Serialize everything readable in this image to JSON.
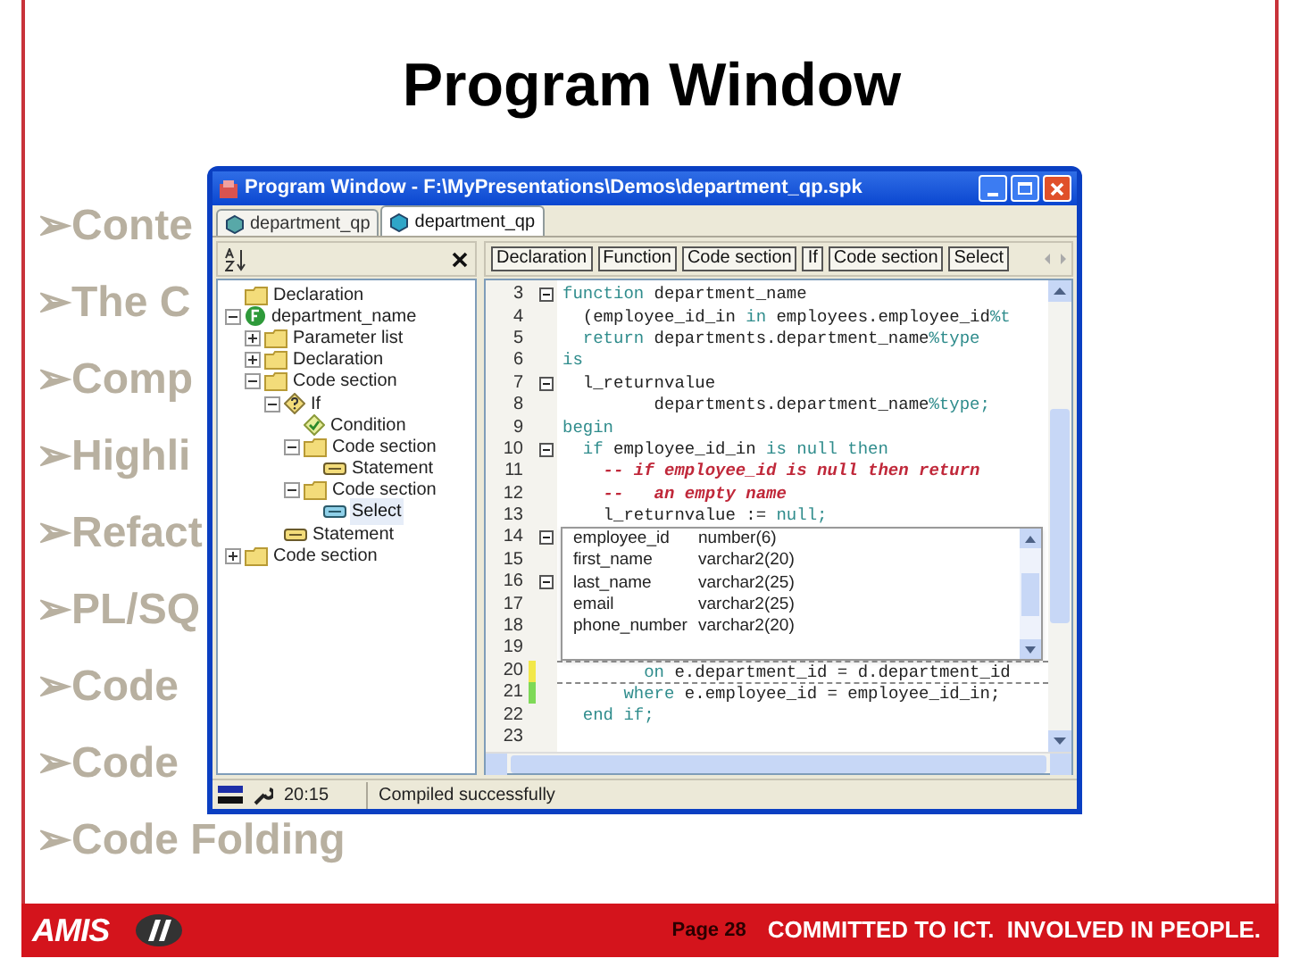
{
  "slide": {
    "title": "Program Window",
    "bullets": [
      "➢Conte",
      "➢The C",
      "➢Comp",
      "➢Highli",
      "➢Refact",
      "➢PL/SQ",
      "➢Code",
      "➢Code",
      "➢Code Folding"
    ],
    "footer": {
      "logo": "AMIS",
      "page": "Page 28",
      "slogan": "COMMITTED TO ICT.  INVOLVED IN PEOPLE."
    }
  },
  "window": {
    "title": "Program Window - F:\\MyPresentations\\Demos\\department_qp.spk",
    "tabs": [
      {
        "label": "department_qp",
        "selected": false
      },
      {
        "label": "department_qp",
        "selected": true
      }
    ],
    "tree": [
      {
        "label": "Declaration",
        "kind": "folder",
        "selected": false
      },
      {
        "label": "department_name",
        "kind": "function",
        "expanded": true,
        "selected": false,
        "children": [
          {
            "label": "Parameter list",
            "kind": "folder",
            "expanded": false,
            "selected": false
          },
          {
            "label": "Declaration",
            "kind": "folder",
            "expanded": false,
            "selected": false
          },
          {
            "label": "Code section",
            "kind": "folder",
            "expanded": true,
            "selected": false,
            "children": [
              {
                "label": "If",
                "kind": "if",
                "expanded": true,
                "selected": false,
                "children": [
                  {
                    "label": "Condition",
                    "kind": "condition",
                    "selected": false
                  },
                  {
                    "label": "Code section",
                    "kind": "folder",
                    "expanded": true,
                    "selected": false,
                    "children": [
                      {
                        "label": "Statement",
                        "kind": "statement",
                        "selected": false
                      }
                    ]
                  },
                  {
                    "label": "Code section",
                    "kind": "folder",
                    "expanded": true,
                    "selected": false,
                    "children": [
                      {
                        "label": "Select",
                        "kind": "select",
                        "selected": true
                      }
                    ]
                  }
                ]
              },
              {
                "label": "Statement",
                "kind": "statement",
                "selected": false
              }
            ]
          }
        ]
      },
      {
        "label": "Code section",
        "kind": "folder",
        "expanded": false,
        "selected": false
      }
    ],
    "breadcrumb": [
      "Declaration",
      "Function",
      "Code section",
      "If",
      "Code section",
      "Select"
    ],
    "lines": [
      {
        "number": "3",
        "fold": true,
        "kind": "code",
        "segments": [
          {
            "text": "function",
            "kind": "keyword"
          },
          {
            "text": " department_name",
            "kind": "plain"
          }
        ]
      },
      {
        "number": "4",
        "fold": false,
        "kind": "code",
        "segments": [
          {
            "text": "  (employee_id_in ",
            "kind": "plain"
          },
          {
            "text": "in",
            "kind": "keyword"
          },
          {
            "text": " employees.employee_id",
            "kind": "plain"
          },
          {
            "text": "%t",
            "kind": "keyword"
          }
        ]
      },
      {
        "number": "5",
        "fold": false,
        "kind": "code",
        "segments": [
          {
            "text": "  return",
            "kind": "keyword"
          },
          {
            "text": " departments.department_name",
            "kind": "plain"
          },
          {
            "text": "%type",
            "kind": "keyword"
          }
        ]
      },
      {
        "number": "6",
        "fold": false,
        "kind": "code",
        "segments": [
          {
            "text": "is",
            "kind": "keyword"
          }
        ]
      },
      {
        "number": "7",
        "fold": true,
        "kind": "code",
        "segments": [
          {
            "text": "  l_returnvalue",
            "kind": "plain"
          }
        ]
      },
      {
        "number": "8",
        "fold": false,
        "kind": "code",
        "segments": [
          {
            "text": "         departments.department_name",
            "kind": "plain"
          },
          {
            "text": "%type;",
            "kind": "keyword"
          }
        ]
      },
      {
        "number": "9",
        "fold": false,
        "kind": "code",
        "segments": [
          {
            "text": "begin",
            "kind": "keyword"
          }
        ]
      },
      {
        "number": "10",
        "fold": true,
        "kind": "code",
        "segments": [
          {
            "text": "  if",
            "kind": "keyword"
          },
          {
            "text": " employee_id_in ",
            "kind": "plain"
          },
          {
            "text": "is null then",
            "kind": "keyword"
          }
        ]
      },
      {
        "number": "11",
        "fold": false,
        "kind": "code",
        "segments": [
          {
            "text": "    -- if employee_id is null then return",
            "kind": "comment"
          }
        ]
      },
      {
        "number": "12",
        "fold": false,
        "kind": "code",
        "segments": [
          {
            "text": "    --   an empty name",
            "kind": "comment"
          }
        ]
      },
      {
        "number": "13",
        "fold": false,
        "kind": "code",
        "segments": [
          {
            "text": "    l_returnvalue := ",
            "kind": "plain"
          },
          {
            "text": "null;",
            "kind": "keyword"
          }
        ]
      },
      {
        "number": "14",
        "fold": true,
        "kind": "column",
        "name": "employee_id",
        "type": "number(6)"
      },
      {
        "number": "15",
        "fold": false,
        "kind": "column",
        "name": "first_name",
        "type": "varchar2(20)"
      },
      {
        "number": "16",
        "fold": true,
        "kind": "column",
        "name": "last_name",
        "type": "varchar2(25)"
      },
      {
        "number": "17",
        "fold": false,
        "kind": "column",
        "name": "email",
        "type": "varchar2(25)"
      },
      {
        "number": "18",
        "fold": false,
        "kind": "column",
        "name": "phone_number",
        "type": "varchar2(20)"
      },
      {
        "number": "19",
        "fold": false,
        "kind": "column"
      },
      {
        "number": "20",
        "fold": false,
        "kind": "code",
        "color": "#f2e84a",
        "segments": [
          {
            "text": "        on",
            "kind": "keyword"
          },
          {
            "text": " e.department_id = d.department_id",
            "kind": "plain"
          }
        ]
      },
      {
        "number": "21",
        "fold": false,
        "kind": "code",
        "color": "#7ed957",
        "segments": [
          {
            "text": "      where",
            "kind": "keyword"
          },
          {
            "text": " e.employee_id = employee_id_in;",
            "kind": "plain"
          }
        ]
      },
      {
        "number": "22",
        "fold": false,
        "kind": "code",
        "segments": [
          {
            "text": "  end if;",
            "kind": "keyword"
          }
        ]
      },
      {
        "number": "23",
        "fold": false,
        "kind": "code"
      }
    ],
    "status": {
      "time": "20:15",
      "message": "Compiled successfully"
    }
  }
}
